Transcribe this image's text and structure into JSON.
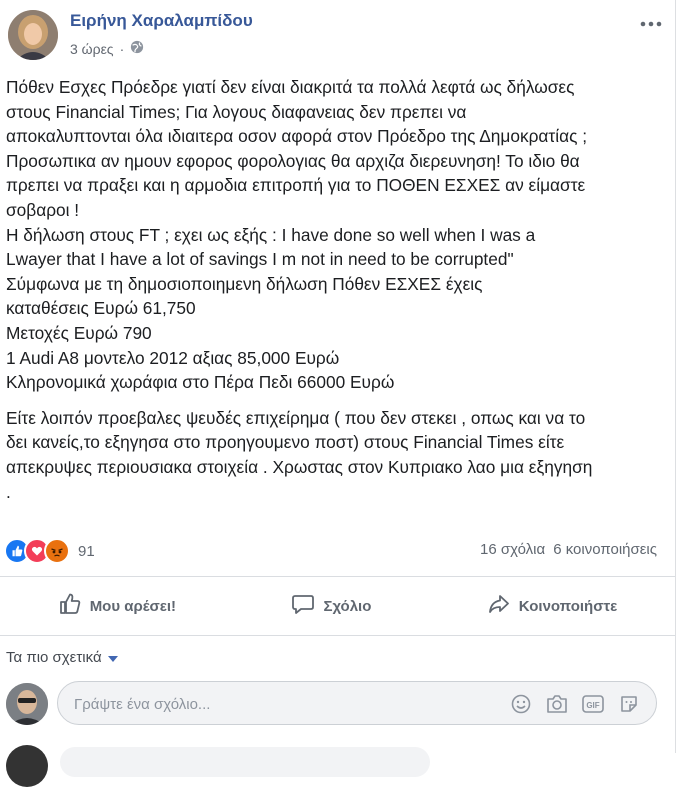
{
  "post": {
    "author": "Ειρήνη Χαραλαμπίδου",
    "time": "3 ώρες",
    "privacy_icon": "globe-icon",
    "paragraph1_lines": [
      "Πόθεν Εσχες Πρόεδρε γιατί δεν είναι διακριτά τα πολλά λεφτά ως δήλωσες",
      "στους Financial Times; Για λογους διαφανειας δεν πρεπει να",
      "αποκαλυπτονται όλα ιδιαιτερα οσον αφορά στον Πρόεδρο της Δημοκρατίας ;",
      "Προσωπικα αν ημουν εφορος φορολογιας θα αρχιζα διερευνηση! Το ιδιο θα",
      "πρεπει να πραξει και η αρμοδια επιτροπή για το ΠΟΘΕΝ ΕΣΧΕΣ αν είμαστε",
      "σοβαροι !",
      "Η δήλωση στους FT ; εχει ως εξής : I have done so well when I was a",
      "Lwayer that I have a lot of savings I m not in need to be corrupted\"",
      "Σύμφωνα με τη δημοσιοποιημενη δήλωση Πόθεν ΕΣΧΕΣ έχεις",
      "καταθέσεις Ευρώ 61,750",
      "Μετοχές Ευρώ 790",
      "1 Audi A8 μοντελο 2012 αξιας 85,000 Ευρώ",
      "Κληρονομικά χωράφια στο Πέρα Πεδι 66000 Ευρώ"
    ],
    "paragraph2_lines": [
      "Είτε λοιπόν προεβαλες ψευδές επιχείρημα ( που δεν στεκει , οπως και να το",
      "δει κανείς,το εξηγησα στο προηγουμενο ποστ) στους Financial Times είτε",
      "απεκρυψες περιουσιακα στοιχεία . Χρωστας στον Κυπριακο λαο μια εξηγηση",
      "."
    ]
  },
  "reactions": {
    "count": "91",
    "types": [
      "like-icon",
      "love-icon",
      "angry-icon"
    ]
  },
  "stats": {
    "comments": "16 σχόλια",
    "shares": "6 κοινοποιήσεις"
  },
  "actions": {
    "like": "Μου αρέσει!",
    "comment": "Σχόλιο",
    "share": "Κοινοποιήστε"
  },
  "comments": {
    "sort_label": "Τα πιο σχετικά",
    "input_placeholder": "Γράψτε ένα σχόλιο..."
  },
  "colors": {
    "author_link": "#385898",
    "like_blue": "#1877f2",
    "love_red": "#f33e58",
    "angry_orange": "#e9710f"
  }
}
